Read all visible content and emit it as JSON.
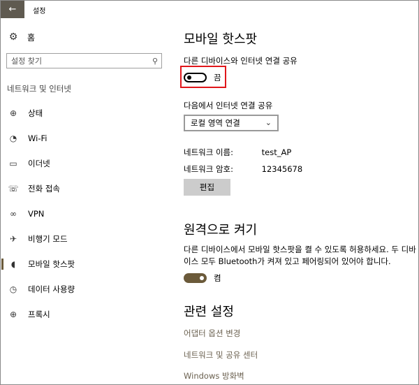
{
  "window": {
    "title": "설정",
    "back_icon": "←"
  },
  "sidebar": {
    "home": {
      "icon": "⚙",
      "label": "홈"
    },
    "search": {
      "placeholder": "설정 찾기",
      "icon": "⚲"
    },
    "section_label": "네트워크 및 인터넷",
    "items": [
      {
        "icon": "⊕",
        "label": "상태"
      },
      {
        "icon": "◔",
        "label": "Wi-Fi"
      },
      {
        "icon": "▭",
        "label": "이더넷"
      },
      {
        "icon": "☏",
        "label": "전화 접속"
      },
      {
        "icon": "∞",
        "label": "VPN"
      },
      {
        "icon": "✈",
        "label": "비행기 모드"
      },
      {
        "icon": "◖",
        "label": "모바일 핫스팟"
      },
      {
        "icon": "◷",
        "label": "데이터 사용량"
      },
      {
        "icon": "⊕",
        "label": "프록시"
      }
    ],
    "active_index": 6,
    "accent": "#6b5a3a"
  },
  "main": {
    "title": "모바일 핫스팟",
    "share_label": "다른 디바이스와 인터넷 연결 공유",
    "share_toggle": {
      "state": "off",
      "label": "끔"
    },
    "share_from_label": "다음에서 인터넷 연결 공유",
    "share_from_value": "로컬 영역 연결",
    "network_name": {
      "key": "네트워크 이름:",
      "value": "test_AP"
    },
    "network_password": {
      "key": "네트워크 암호:",
      "value": "12345678"
    },
    "edit_button": "편집",
    "remote_title": "원격으로 켜기",
    "remote_desc": "다른 디바이스에서 모바일 핫스팟을 켤 수 있도록 허용하세요. 두 디바이스 모두 Bluetooth가 켜져 있고 페어링되어 있어야 합니다.",
    "remote_toggle": {
      "state": "on",
      "label": "켬"
    },
    "related_title": "관련 설정",
    "links": [
      "어댑터 옵션 변경",
      "네트워크 및 공유 센터",
      "Windows 방화벽"
    ]
  }
}
